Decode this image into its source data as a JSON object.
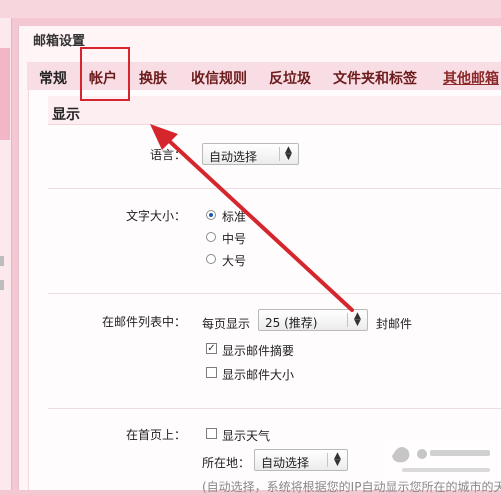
{
  "page": {
    "title": "邮箱设置"
  },
  "tabs": [
    {
      "label": "常规",
      "active": true
    },
    {
      "label": "帐户",
      "highlighted": true
    },
    {
      "label": "换肤"
    },
    {
      "label": "收信规则"
    },
    {
      "label": "反垃圾"
    },
    {
      "label": "文件夹和标签"
    },
    {
      "label": "其他邮箱",
      "link": true
    }
  ],
  "section": {
    "title": "显示"
  },
  "language": {
    "label": "语言：",
    "value": "自动选择"
  },
  "font_size": {
    "label": "文字大小：",
    "options": [
      {
        "label": "标准",
        "selected": true
      },
      {
        "label": "中号",
        "selected": false
      },
      {
        "label": "大号",
        "selected": false
      }
    ]
  },
  "mail_list": {
    "label": "在邮件列表中：",
    "per_page_prefix": "每页显示",
    "per_page_value": "25 (推荐)",
    "per_page_suffix": "封邮件",
    "show_summary": {
      "label": "显示邮件摘要",
      "checked": true
    },
    "show_size": {
      "label": "显示邮件大小",
      "checked": false
    }
  },
  "homepage": {
    "label": "在首页上：",
    "show_weather": {
      "label": "显示天气",
      "checked": false
    },
    "location_label": "所在地：",
    "location_value": "自动选择",
    "hint": "(自动选择，系统将根据您的IP自动显示您所在的城市的天"
  },
  "colors": {
    "accent": "#d6262d",
    "tab_text": "#6b1b1b",
    "panel_bg": "#fff4f6"
  },
  "icons": {
    "dropdown": "dropdown-arrows-icon",
    "arrow": "red-arrow-annotation"
  }
}
